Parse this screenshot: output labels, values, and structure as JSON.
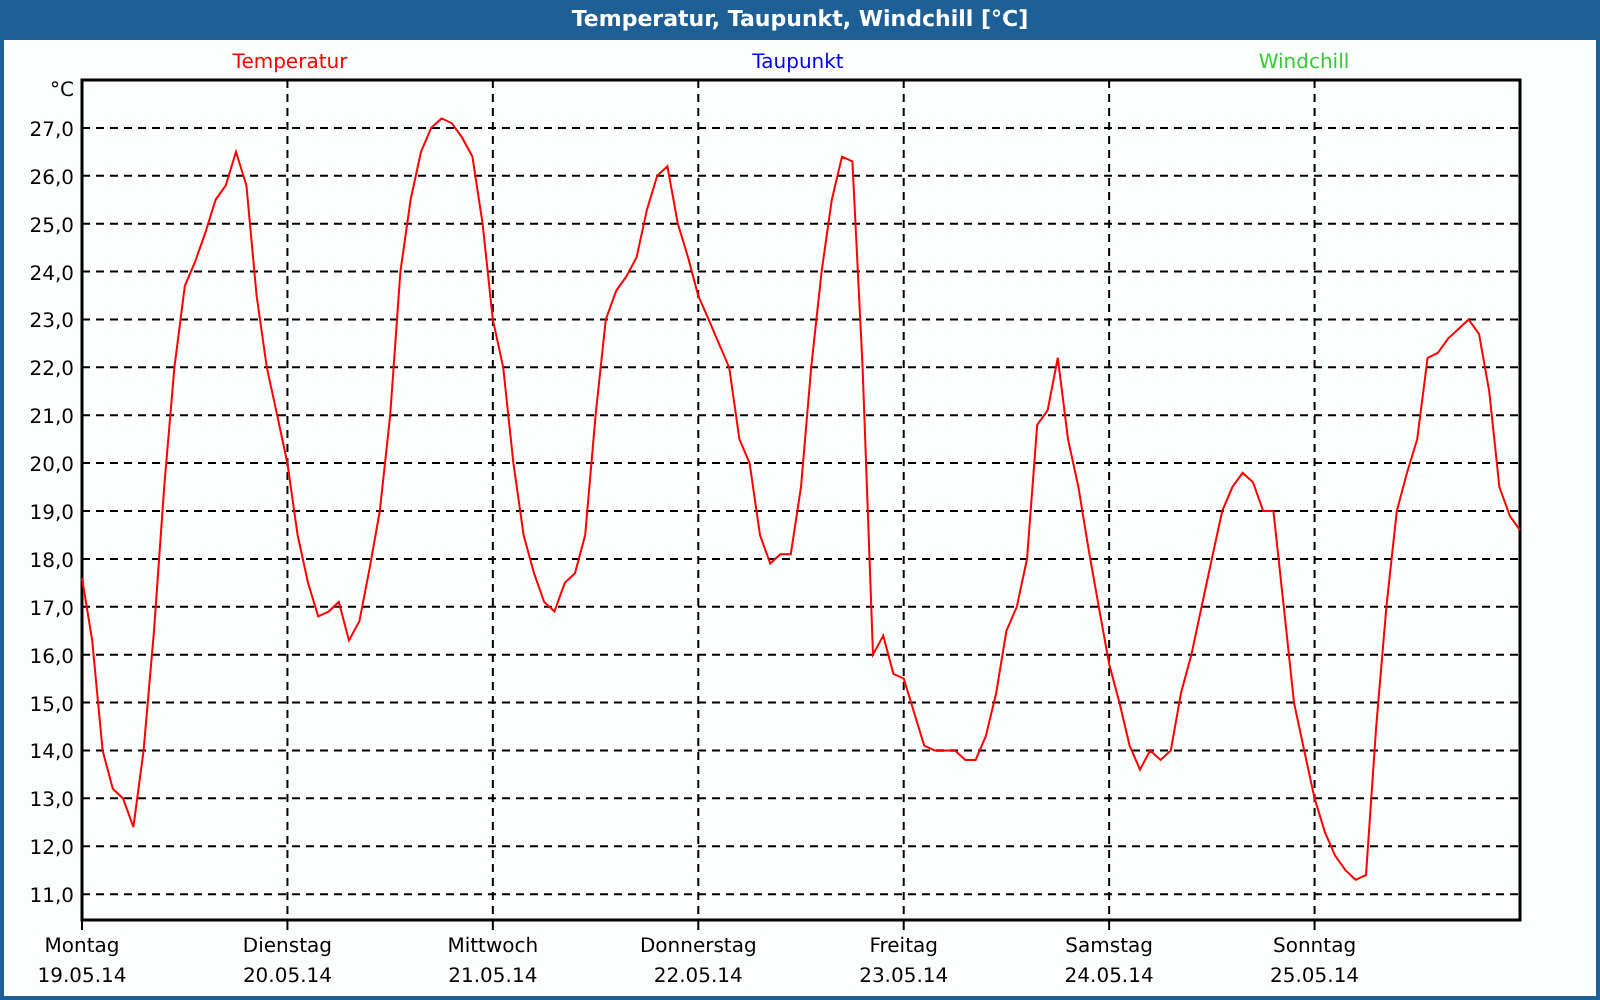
{
  "window": {
    "title": "Temperatur, Taupunkt, Windchill [°C]"
  },
  "chart_data": {
    "type": "line",
    "ylabel": "°C",
    "grid": true,
    "ylim": [
      10.46,
      28
    ],
    "categories": [
      "Montag\n19.05.14",
      null,
      null,
      null,
      null,
      null,
      null,
      null,
      null,
      null,
      null,
      null,
      null,
      null,
      null,
      null,
      null,
      null,
      null,
      null,
      "Dienstag\n20.05.14",
      null,
      null,
      null,
      null,
      null,
      null,
      null,
      null,
      null,
      null,
      null,
      null,
      null,
      null,
      null,
      null,
      null,
      null,
      null,
      "Mittwoch\n21.05.14",
      null,
      null,
      null,
      null,
      null,
      null,
      null,
      null,
      null,
      null,
      null,
      null,
      null,
      null,
      null,
      null,
      null,
      null,
      null,
      "Donnerstag\n22.05.14",
      null,
      null,
      null,
      null,
      null,
      null,
      null,
      null,
      null,
      null,
      null,
      null,
      null,
      null,
      null,
      null,
      null,
      null,
      null,
      "Freitag\n23.05.14",
      null,
      null,
      null,
      null,
      null,
      null,
      null,
      null,
      null,
      null,
      null,
      null,
      null,
      null,
      null,
      null,
      null,
      null,
      null,
      "Samstag\n24.05.14",
      null,
      null,
      null,
      null,
      null,
      null,
      null,
      null,
      null,
      null,
      null,
      null,
      null,
      null,
      null,
      null,
      null,
      null,
      null,
      "Sonntag\n25.05.14",
      null,
      null,
      null,
      null,
      null,
      null,
      null,
      null,
      null,
      null,
      null,
      null,
      null,
      null,
      null,
      null,
      null,
      null,
      null,
      null
    ],
    "yticks": [
      {
        "value": 11,
        "label": "11,0"
      },
      {
        "value": 12,
        "label": "12,0"
      },
      {
        "value": 13,
        "label": "13,0"
      },
      {
        "value": 14,
        "label": "14,0"
      },
      {
        "value": 15,
        "label": "15,0"
      },
      {
        "value": 16,
        "label": "16,0"
      },
      {
        "value": 17,
        "label": "17,0"
      },
      {
        "value": 18,
        "label": "18,0"
      },
      {
        "value": 19,
        "label": "19,0"
      },
      {
        "value": 20,
        "label": "20,0"
      },
      {
        "value": 21,
        "label": "21,0"
      },
      {
        "value": 22,
        "label": "22,0"
      },
      {
        "value": 23,
        "label": "23,0"
      },
      {
        "value": 24,
        "label": "24,0"
      },
      {
        "value": 25,
        "label": "25,0"
      },
      {
        "value": 26,
        "label": "26,0"
      },
      {
        "value": 27,
        "label": "27,0"
      }
    ],
    "series": [
      {
        "name": "Temperatur",
        "color": "#ff0000",
        "values": [
          17.6,
          16.3,
          14.0,
          13.2,
          13.0,
          12.4,
          14.0,
          16.5,
          19.5,
          22.0,
          23.7,
          24.2,
          24.8,
          25.5,
          25.8,
          26.5,
          25.8,
          23.5,
          22.0,
          21.0,
          20.0,
          18.5,
          17.5,
          16.8,
          16.9,
          17.1,
          16.3,
          16.7,
          17.8,
          19.0,
          21.0,
          24.0,
          25.5,
          26.5,
          27.0,
          27.2,
          27.1,
          26.8,
          26.4,
          25.0,
          23.0,
          22.0,
          20.0,
          18.5,
          17.7,
          17.1,
          16.9,
          17.5,
          17.7,
          18.5,
          21.0,
          23.0,
          23.6,
          23.9,
          24.3,
          25.3,
          26.0,
          26.2,
          25.0,
          24.3,
          23.5,
          23.0,
          22.5,
          22.0,
          20.5,
          20.0,
          18.5,
          17.9,
          18.1,
          18.1,
          19.5,
          22.0,
          24.0,
          25.5,
          26.4,
          26.3,
          22.0,
          16.0,
          16.4,
          15.6,
          15.5,
          14.8,
          14.1,
          14.0,
          14.0,
          14.0,
          13.8,
          13.8,
          14.3,
          15.2,
          16.5,
          17.0,
          18.0,
          20.8,
          21.1,
          22.2,
          20.5,
          19.5,
          18.2,
          17.0,
          15.8,
          15.0,
          14.1,
          13.6,
          14.0,
          13.8,
          14.0,
          15.2,
          16.0,
          17.0,
          18.0,
          19.0,
          19.5,
          19.8,
          19.6,
          19.0,
          19.0,
          17.0,
          15.0,
          14.0,
          13.0,
          12.3,
          11.8,
          11.5,
          11.3,
          11.4,
          14.5,
          17.0,
          19.0,
          19.8,
          20.5,
          22.2,
          22.3,
          22.6,
          22.8,
          23.0,
          22.7,
          21.5,
          19.5,
          18.9,
          18.6
        ]
      },
      {
        "name": "Taupunkt",
        "color": "#0000ff",
        "values": [
          null,
          null,
          null,
          null,
          null,
          null,
          null,
          null,
          null,
          null,
          null,
          null,
          null,
          null,
          null,
          null,
          null,
          null,
          null,
          null,
          null,
          null,
          null,
          null,
          null,
          null,
          null,
          null,
          null,
          null,
          null,
          null,
          null,
          null,
          null,
          null,
          null,
          null,
          null,
          null,
          null,
          null,
          null,
          null,
          null,
          null,
          null,
          null,
          null,
          null,
          null,
          null,
          null,
          null,
          null,
          null,
          null,
          null,
          null,
          null,
          null,
          null,
          null,
          null,
          null,
          null,
          null,
          null,
          null,
          null,
          null,
          null,
          null,
          null,
          null,
          null,
          null,
          null,
          null,
          null,
          null,
          null,
          null,
          null,
          null,
          null,
          null,
          null,
          null,
          null,
          null,
          null,
          null,
          null,
          null,
          null,
          null,
          null,
          null,
          null,
          null,
          null,
          null,
          null,
          null,
          null,
          null,
          null,
          null,
          null,
          null,
          null,
          null,
          null,
          null,
          null,
          null,
          null,
          null,
          null,
          null,
          null,
          null,
          null,
          null,
          null,
          null,
          null,
          null,
          null,
          null,
          null,
          null,
          null,
          null,
          null,
          null,
          null,
          null,
          null,
          null
        ]
      },
      {
        "name": "Windchill",
        "color": "#33cc33",
        "values": [
          null,
          null,
          null,
          null,
          null,
          null,
          null,
          null,
          null,
          null,
          null,
          null,
          null,
          null,
          null,
          null,
          null,
          null,
          null,
          null,
          null,
          null,
          null,
          null,
          null,
          null,
          null,
          null,
          null,
          null,
          null,
          null,
          null,
          null,
          null,
          null,
          null,
          null,
          null,
          null,
          null,
          null,
          null,
          null,
          null,
          null,
          null,
          null,
          null,
          null,
          null,
          null,
          null,
          null,
          null,
          null,
          null,
          null,
          null,
          null,
          null,
          null,
          null,
          null,
          null,
          null,
          null,
          null,
          null,
          null,
          null,
          null,
          null,
          null,
          null,
          null,
          null,
          null,
          null,
          null,
          null,
          null,
          null,
          null,
          null,
          null,
          null,
          null,
          null,
          null,
          null,
          null,
          null,
          null,
          null,
          null,
          null,
          null,
          null,
          null,
          null,
          null,
          null,
          null,
          null,
          null,
          null,
          null,
          null,
          null,
          null,
          null,
          null,
          null,
          null,
          null,
          null,
          null,
          null,
          null,
          null,
          null,
          null,
          null,
          null,
          null,
          null,
          null,
          null,
          null,
          null,
          null,
          null,
          null,
          null,
          null,
          null,
          null,
          null,
          null,
          null
        ]
      }
    ]
  }
}
